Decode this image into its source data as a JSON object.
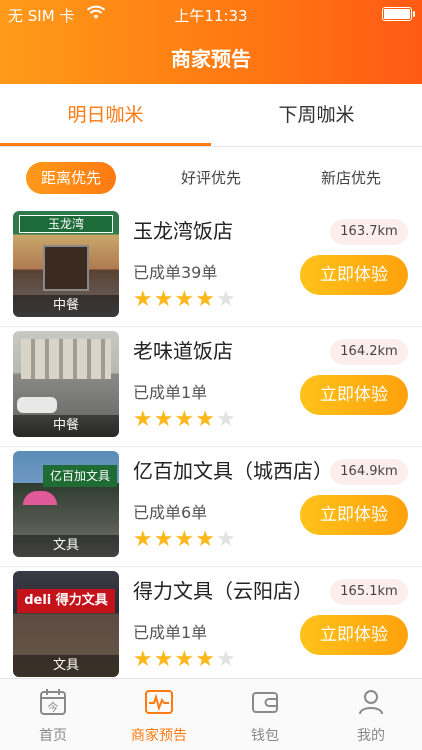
{
  "status_bar": {
    "carrier": "无 SIM 卡",
    "time": "上午11:33"
  },
  "header": {
    "title": "商家预告"
  },
  "tabs": [
    {
      "label": "明日咖米",
      "active": true
    },
    {
      "label": "下周咖米",
      "active": false
    }
  ],
  "filters": [
    {
      "label": "距离优先",
      "active": true
    },
    {
      "label": "好评优先",
      "active": false
    },
    {
      "label": "新店优先",
      "active": false
    }
  ],
  "stores": [
    {
      "name": "玉龙湾饭店",
      "distance": "163.7km",
      "orders": "已成单39单",
      "category": "中餐",
      "rating": 4,
      "rating_max": 5,
      "button": "立即体验",
      "sign": "玉龙湾"
    },
    {
      "name": "老味道饭店",
      "distance": "164.2km",
      "orders": "已成单1单",
      "category": "中餐",
      "rating": 4,
      "rating_max": 5,
      "button": "立即体验"
    },
    {
      "name": "亿百加文具（城西店）",
      "distance": "164.9km",
      "orders": "已成单6单",
      "category": "文具",
      "rating": 4,
      "rating_max": 5,
      "button": "立即体验",
      "sign": "亿百加文具"
    },
    {
      "name": "得力文具（云阳店）",
      "distance": "165.1km",
      "orders": "已成单1单",
      "category": "文具",
      "rating": 4,
      "rating_max": 5,
      "button": "立即体验",
      "sign": "deli 得力文具"
    }
  ],
  "tabbar": {
    "items": [
      {
        "label": "首页",
        "icon": "calendar-icon",
        "active": false
      },
      {
        "label": "商家预告",
        "icon": "pulse-icon",
        "active": true
      },
      {
        "label": "钱包",
        "icon": "wallet-icon",
        "active": false
      },
      {
        "label": "我的",
        "icon": "user-icon",
        "active": false
      }
    ],
    "calendar_day": "今"
  },
  "colors": {
    "accent": "#ff7a12",
    "button": "#ffa10c",
    "star": "#ffb81c",
    "distance_bg": "#fdeeee"
  }
}
